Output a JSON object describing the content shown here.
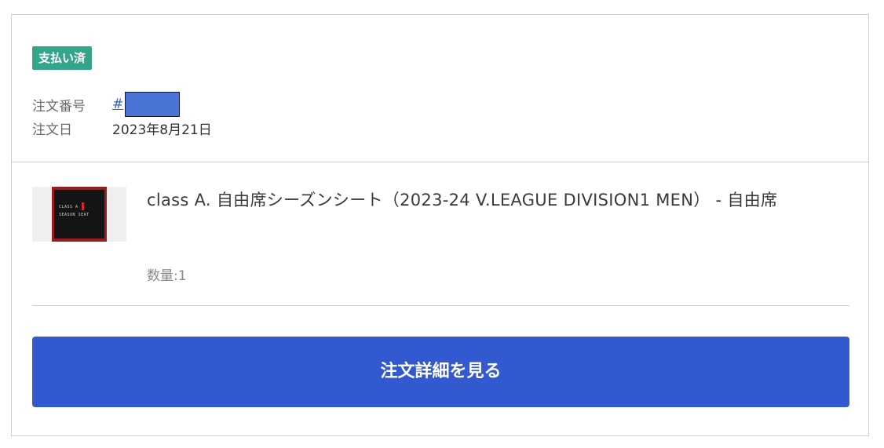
{
  "order": {
    "status_badge": "支払い済",
    "order_number_label": "注文番号",
    "order_number_link": "#",
    "order_date_label": "注文日",
    "order_date_value": "2023年8月21日"
  },
  "item": {
    "title": "class A. 自由席シーズンシート（2023-24 V.LEAGUE DIVISION1 MEN） - 自由席",
    "quantity": "数量:1",
    "thumbnail_text_line1": "CLASS A",
    "thumbnail_text_line2": "SEASON SEAT"
  },
  "actions": {
    "detail_button_label": "注文詳細を見る"
  },
  "colors": {
    "status_badge_bg": "#34a48c",
    "primary_button_bg": "#3259cf",
    "link": "#2f5fd4",
    "redaction": "#4a74d6"
  }
}
